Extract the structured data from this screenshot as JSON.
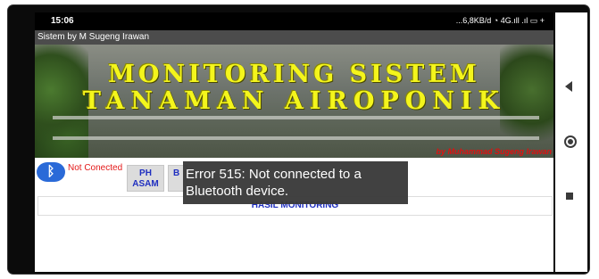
{
  "statusbar": {
    "time": "15:06",
    "indicators": "...6,8KB/d ◔ 4G.ıll .ıl ▭ +"
  },
  "app": {
    "title": "Sistem by M Sugeng Irawan"
  },
  "banner": {
    "line1": "MONITORING SISTEM",
    "line2": "TANAMAN AIROPONIK",
    "credit": "by Muhammad Sugeng Irawan"
  },
  "controls": {
    "bluetooth_icon": "bluetooth-icon",
    "connection_status": "Not Conected",
    "ph_button": "PH\nASAM",
    "b_button": "B"
  },
  "panel": {
    "label": "HASIL MONITORING"
  },
  "toast": {
    "message": "Error 515: Not connected to a Bluetooth device."
  },
  "navbar": {
    "back_icon": "back-triangle-icon",
    "home_icon": "home-circle-icon",
    "recent_icon": "recent-apps-square-icon"
  },
  "colors": {
    "banner_title": "#f4f51c",
    "credit": "#e01010",
    "status_error": "#e31818",
    "button_text": "#1f2fc0",
    "toast_bg": "#3a3a3a"
  }
}
